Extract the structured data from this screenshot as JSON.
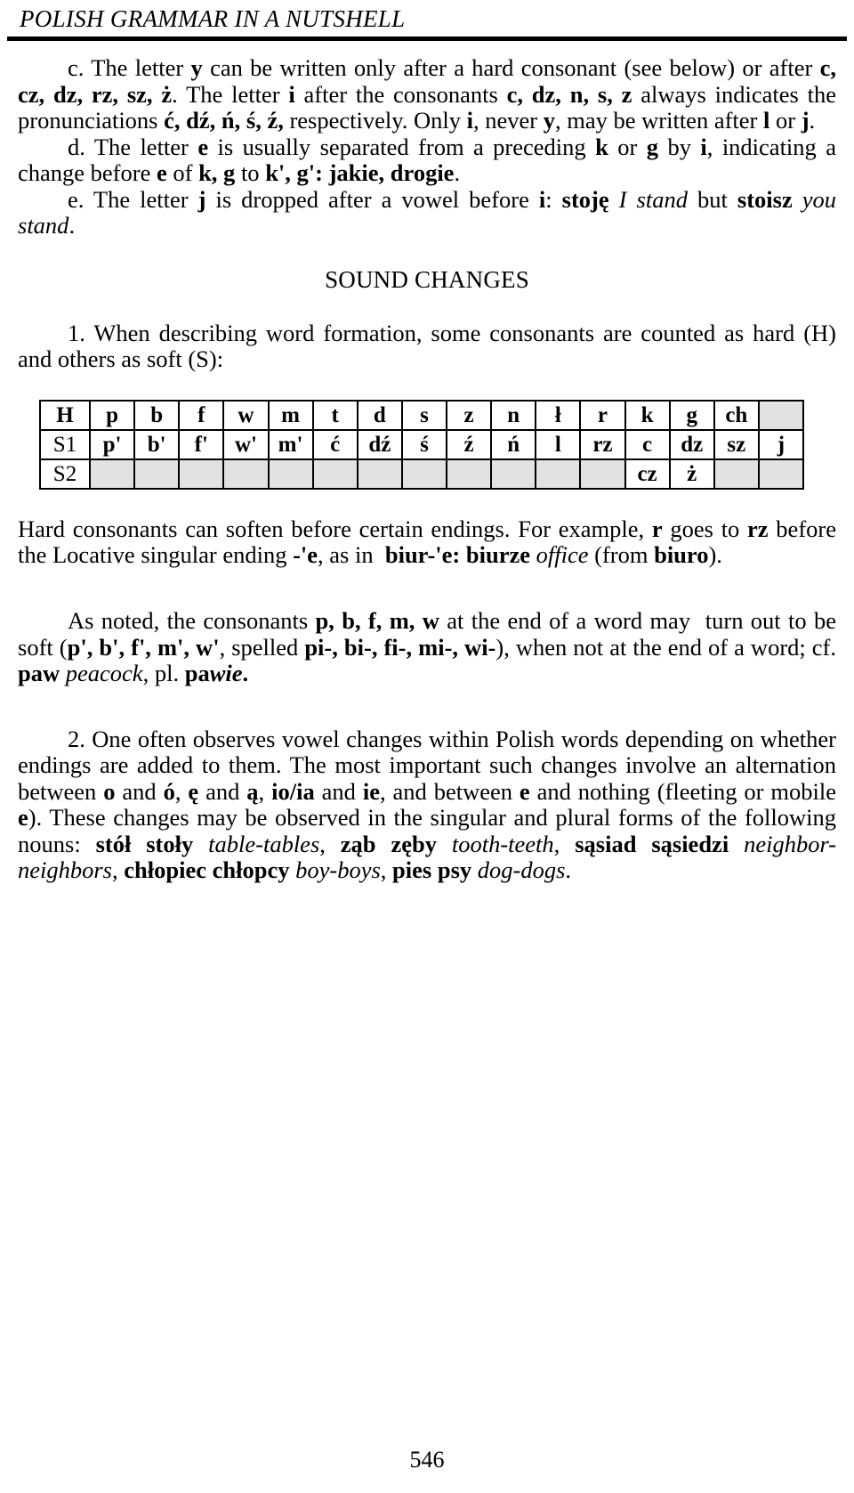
{
  "running_head": "POLISH GRAMMAR IN A NUTSHELL",
  "paragraphs": {
    "c": {
      "marker": "c.",
      "text": "c. The letter y can be written only after a hard consonant (see below) or after c, cz, dz, rz, sz, ż. The letter i after the consonants c, dz, n, s, z always indicates the pronunciations ć, dź, ń, ś, ź, respectively. Only i, never y, may be written after l or j."
    },
    "d": {
      "marker": "d.",
      "text": "d. The letter e is usually separated from a preceding k or g by i, indicating a change before e of k, g to k', g': jakie, drogie."
    },
    "e": {
      "marker": "e.",
      "text": "e. The letter j is dropped after a vowel before i: stoję I stand but stoisz you stand."
    },
    "item1": {
      "text": "1. When describing word formation, some consonants are counted as hard (H) and others as soft (S):"
    },
    "after_table": {
      "text": "Hard consonants can soften before certain endings. For example, r goes to rz before the Locative singular ending -'e, as in  biur-'e: biurze office (from biuro)."
    },
    "as_noted": {
      "text": "As noted, the consonants p, b, f, m, w at the end of a word may turn out to be soft (p', b', f', m', w', spelled pi-, bi-, fi-, mi-, wi-), when not at the end of a word; cf. paw peacock, pl. pawie."
    },
    "item2": {
      "text": "2. One often observes vowel changes within Polish words depending on whether endings are added to them. The most important such changes involve an alternation between o and ó, ę and ą, io/ia and ie, and between e and nothing (fleeting or mobile e). These changes may be observed in the singular and plural forms of the following nouns: stół stoły table-tables, ząb zęby tooth-teeth, sąsiad sąsiedzi neighbor-neighbors, chłopiec chłopcy boy-boys, pies psy dog-dogs."
    }
  },
  "section_heading": "SOUND CHANGES",
  "table": {
    "row_labels": [
      "H",
      "S1",
      "S2"
    ],
    "columns": 17,
    "rows": {
      "H": [
        "p",
        "b",
        "f",
        "w",
        "m",
        "t",
        "d",
        "s",
        "z",
        "n",
        "ł",
        "r",
        "k",
        "g",
        "ch",
        ""
      ],
      "S1": [
        "p'",
        "b'",
        "f'",
        "w'",
        "m'",
        "ć",
        "dź",
        "ś",
        "ź",
        "ń",
        "l",
        "rz",
        "c",
        "dz",
        "sz",
        "j"
      ],
      "S2": [
        "",
        "",
        "",
        "",
        "",
        "",
        "",
        "",
        "",
        "",
        "",
        "",
        "cz",
        "ż",
        "",
        ""
      ]
    },
    "shade_color": "#e2e2e2"
  },
  "folio": "546"
}
